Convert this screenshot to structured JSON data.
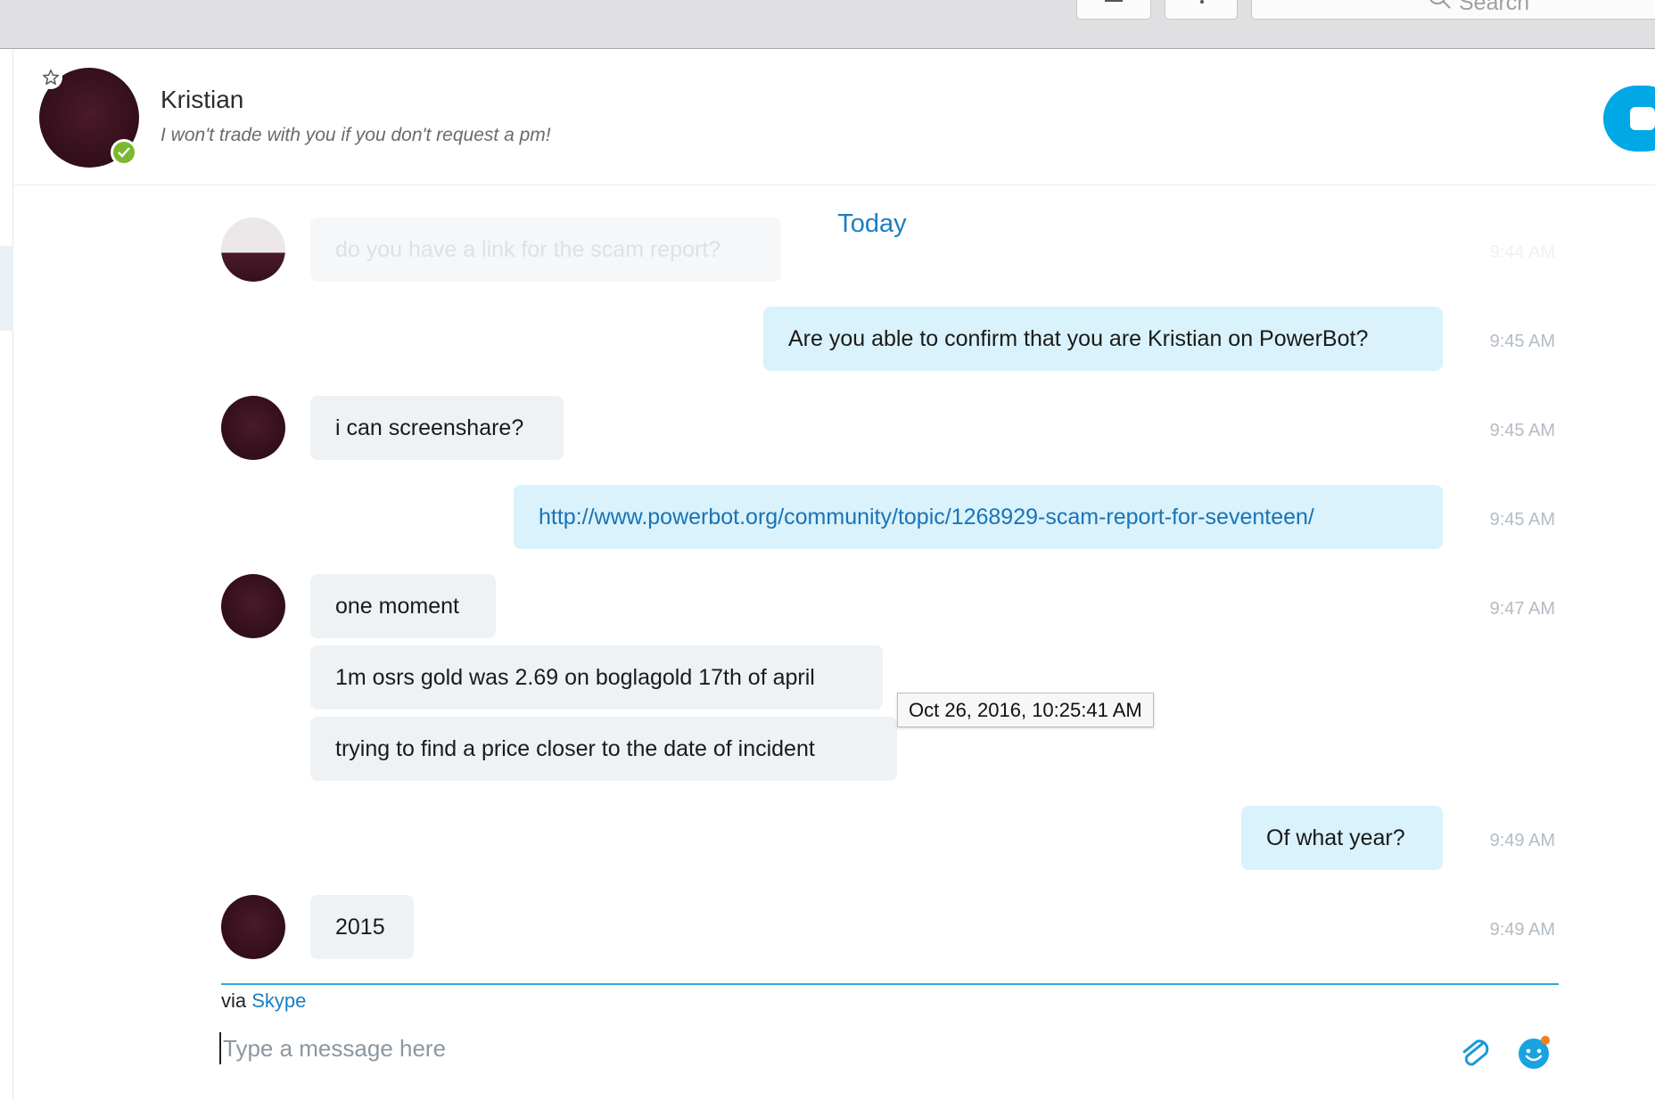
{
  "titlebar": {
    "search_placeholder": "Search",
    "buttons": [
      "compose-icon",
      "dialpad-icon"
    ]
  },
  "header": {
    "name": "Kristian",
    "mood": "I won't trade with you if you don't request a pm!",
    "status": "online",
    "status_color": "#7cb82f",
    "favorite_icon": "star-outline-icon",
    "call_icon": "video-camera-icon",
    "accent_color": "#00a8e6"
  },
  "chat": {
    "date_divider": "Today",
    "tooltip": "Oct 26, 2016, 10:25:41 AM",
    "messages": [
      {
        "from": "them",
        "text": "do you have a link for the scam report?",
        "time": "9:44 AM",
        "faded": true
      },
      {
        "from": "me",
        "text": "Are you able to confirm that you are Kristian on PowerBot?",
        "time": "9:45 AM"
      },
      {
        "from": "them",
        "text": "i can screenshare?",
        "time": "9:45 AM"
      },
      {
        "from": "me",
        "text": "http://www.powerbot.org/community/topic/1268929-scam-report-for-seventeen/",
        "time": "9:45 AM",
        "is_link": true
      },
      {
        "from": "them",
        "text": "one moment",
        "time": "9:47 AM"
      },
      {
        "from": "them",
        "text": "1m osrs gold was 2.69 on boglagold 17th of april"
      },
      {
        "from": "them",
        "text": "trying to find a price closer to the date of incident"
      },
      {
        "from": "me",
        "text": "Of what year?",
        "time": "9:49 AM"
      },
      {
        "from": "them",
        "text": "2015",
        "time": "9:49 AM"
      }
    ]
  },
  "composer": {
    "via_prefix": "via",
    "via_service": "Skype",
    "placeholder": "Type a message here",
    "attach_icon": "paperclip-icon",
    "emoji_icon": "emoji-smiley-icon"
  },
  "colors": {
    "outgoing_bubble": "#d9f2fb",
    "incoming_bubble": "#eff2f5",
    "link": "#1a73b5",
    "date_divider": "#1a7fc1"
  }
}
